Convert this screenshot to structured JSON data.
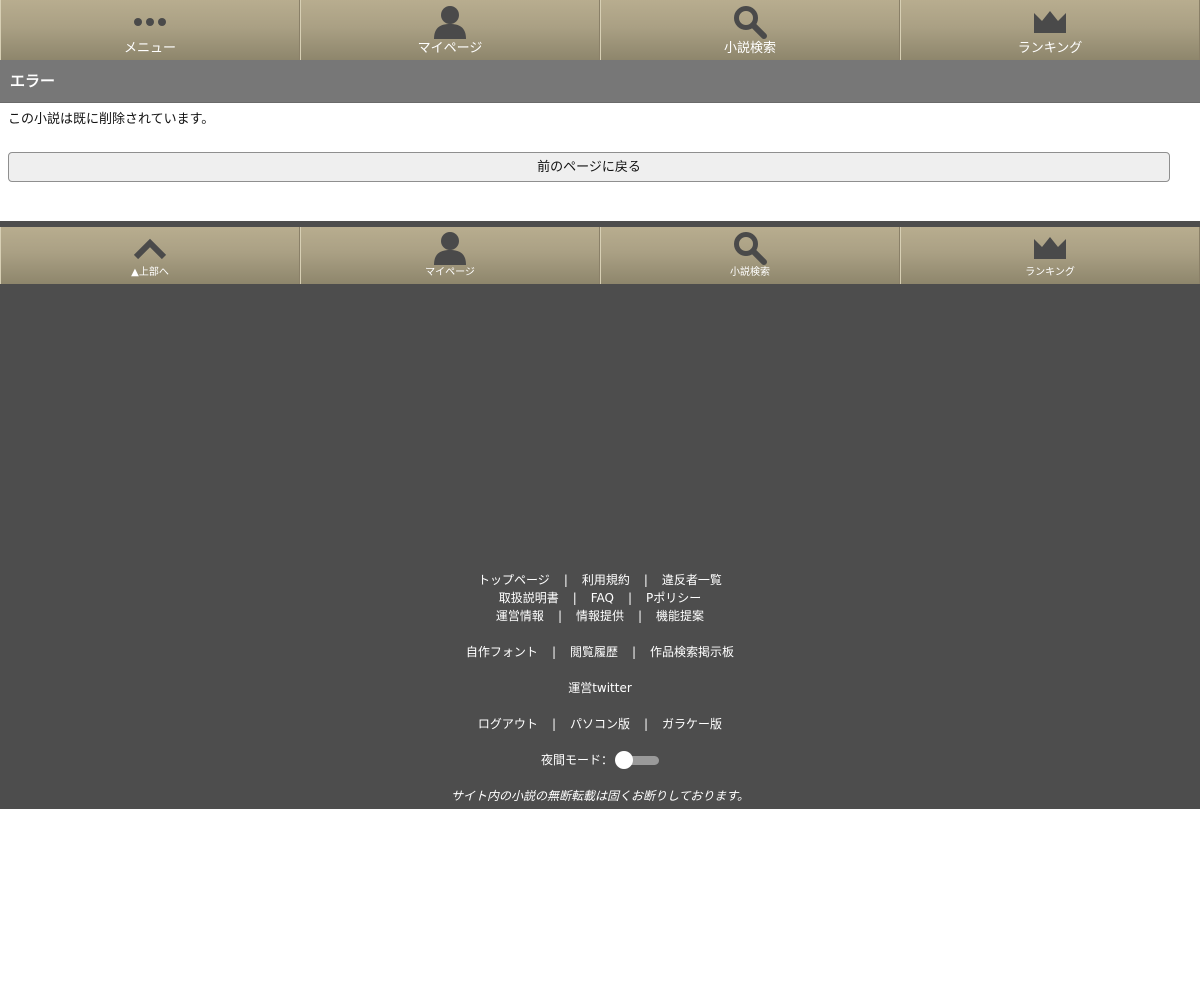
{
  "top_nav": {
    "items": [
      {
        "label": "メニュー",
        "icon": "ellipsis-icon"
      },
      {
        "label": "マイページ",
        "icon": "user-icon"
      },
      {
        "label": "小説検索",
        "icon": "search-icon"
      },
      {
        "label": "ランキング",
        "icon": "crown-icon"
      }
    ]
  },
  "error": {
    "title": "エラー",
    "message": "この小説は既に削除されています。",
    "back_label": "前のページに戻る"
  },
  "bottom_nav": {
    "items": [
      {
        "label": "▲上部へ",
        "icon": "chevron-up-icon"
      },
      {
        "label": "マイページ",
        "icon": "user-icon"
      },
      {
        "label": "小説検索",
        "icon": "search-icon"
      },
      {
        "label": "ランキング",
        "icon": "crown-icon"
      }
    ]
  },
  "footer": {
    "links": {
      "top_page": "トップページ",
      "terms": "利用規約",
      "violators": "違反者一覧",
      "manual": "取扱説明書",
      "faq": "FAQ",
      "policy": "Pポリシー",
      "operation_info": "運営情報",
      "info_provide": "情報提供",
      "feature_request": "機能提案",
      "custom_font": "自作フォント",
      "history": "閲覧履歴",
      "search_board": "作品検索掲示板",
      "twitter": "運営twitter",
      "logout": "ログアウト",
      "pc_version": "パソコン版",
      "feature_phone": "ガラケー版"
    },
    "separator": "|",
    "night_mode_label": "夜間モード：",
    "night_mode_on": false,
    "copyright": "サイト内の小説の無断転載は固くお断りしております。"
  },
  "colors": {
    "nav_gradient_top": "#b8ad8f",
    "nav_gradient_bottom": "#8e866c",
    "icon": "#4a4a4a",
    "error_header": "#777777",
    "footer_bg": "#4d4d4d"
  }
}
